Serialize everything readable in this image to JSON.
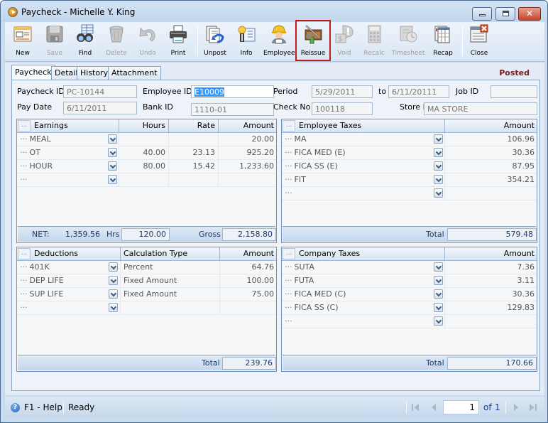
{
  "window": {
    "title": "Paycheck - Michelle Y. King",
    "controls": [
      "minimize",
      "maximize",
      "close"
    ]
  },
  "toolbar": {
    "buttons": [
      {
        "label": "New",
        "icon": "new-record-icon",
        "enabled": true
      },
      {
        "label": "Save",
        "icon": "floppy-disk-icon",
        "enabled": false
      },
      {
        "label": "Find",
        "icon": "binoculars-icon",
        "enabled": true
      },
      {
        "label": "Delete",
        "icon": "trash-can-icon",
        "enabled": false
      },
      {
        "label": "Undo",
        "icon": "undo-arrow-icon",
        "enabled": false
      },
      {
        "label": "Print",
        "icon": "printer-icon",
        "enabled": true
      },
      {
        "label": "Unpost",
        "icon": "unpost-icon",
        "enabled": true
      },
      {
        "label": "Info",
        "icon": "info-badge-icon",
        "enabled": true
      },
      {
        "label": "Employee",
        "icon": "employee-hardhat-icon",
        "enabled": true
      },
      {
        "label": "Reissue",
        "icon": "reissue-tools-icon",
        "enabled": true,
        "highlighted": true
      },
      {
        "label": "Void",
        "icon": "void-money-icon",
        "enabled": false
      },
      {
        "label": "Recalc",
        "icon": "calculator-icon",
        "enabled": false
      },
      {
        "label": "Timesheet",
        "icon": "timesheet-clock-icon",
        "enabled": false
      },
      {
        "label": "Recap",
        "icon": "recap-report-icon",
        "enabled": true
      },
      {
        "label": "Close",
        "icon": "close-window-icon",
        "enabled": true
      }
    ]
  },
  "tabs": [
    {
      "label": "Paycheck",
      "active": true
    },
    {
      "label": "Detail",
      "active": false
    },
    {
      "label": "History",
      "active": false
    },
    {
      "label": "Attachment",
      "active": false
    }
  ],
  "status_label": "Posted",
  "status_color": "#7a1b1b",
  "fields": {
    "paycheck_id": {
      "label": "Paycheck ID",
      "value": "PC-10144"
    },
    "employee_id": {
      "label": "Employee ID",
      "value": "E10009"
    },
    "period": {
      "label": "Period",
      "value": "5/29/2011"
    },
    "period_to": {
      "label": "to",
      "value": "6/11/20111"
    },
    "job_id": {
      "label": "Job ID",
      "value": ""
    },
    "pay_date": {
      "label": "Pay Date",
      "value": "6/11/2011"
    },
    "bank_id": {
      "label": "Bank ID",
      "value": "1110-01"
    },
    "check_no": {
      "label": "Check No",
      "value": "100118"
    },
    "store_id": {
      "label": "Store ID",
      "value": "MA STORE"
    }
  },
  "earnings": {
    "columns": [
      "Earnings",
      "Hours",
      "Rate",
      "Amount"
    ],
    "rows": [
      {
        "name": "MEAL",
        "hours": "",
        "rate": "",
        "amount": "20.00"
      },
      {
        "name": "OT",
        "hours": "40.00",
        "rate": "23.13",
        "amount": "925.20"
      },
      {
        "name": "HOUR",
        "hours": "80.00",
        "rate": "15.42",
        "amount": "1,233.60"
      },
      {
        "name": "",
        "hours": "",
        "rate": "",
        "amount": ""
      }
    ],
    "footer": {
      "net_label": "NET:",
      "net_value": "1,359.56",
      "hrs_label": "Hrs",
      "hrs_value": "120.00",
      "gross_label": "Gross",
      "gross_value": "2,158.80"
    }
  },
  "employee_taxes": {
    "columns": [
      "Employee Taxes",
      "Amount"
    ],
    "rows": [
      {
        "name": "MA",
        "amount": "106.96"
      },
      {
        "name": "FICA MED (E)",
        "amount": "30.36"
      },
      {
        "name": "FICA SS (E)",
        "amount": "87.95"
      },
      {
        "name": "FIT",
        "amount": "354.21"
      },
      {
        "name": "",
        "amount": ""
      }
    ],
    "footer": {
      "total_label": "Total",
      "total_value": "579.48"
    }
  },
  "deductions": {
    "columns": [
      "Deductions",
      "Calculation Type",
      "Amount"
    ],
    "rows": [
      {
        "name": "401K",
        "calc_type": "Percent",
        "amount": "64.76"
      },
      {
        "name": "DEP LIFE",
        "calc_type": "Fixed Amount",
        "amount": "100.00"
      },
      {
        "name": "SUP LIFE",
        "calc_type": "Fixed Amount",
        "amount": "75.00"
      },
      {
        "name": "",
        "calc_type": "",
        "amount": ""
      }
    ],
    "footer": {
      "total_label": "Total",
      "total_value": "239.76"
    }
  },
  "company_taxes": {
    "columns": [
      "Company Taxes",
      "Amount"
    ],
    "rows": [
      {
        "name": "SUTA",
        "amount": "7.36"
      },
      {
        "name": "FUTA",
        "amount": "3.11"
      },
      {
        "name": "FICA MED (C)",
        "amount": "30.36"
      },
      {
        "name": "FICA SS (C)",
        "amount": "129.83"
      },
      {
        "name": "",
        "amount": ""
      }
    ],
    "footer": {
      "total_label": "Total",
      "total_value": "170.66"
    }
  },
  "statusbar": {
    "help": "F1 - Help",
    "state": "Ready",
    "page": "1",
    "of_label": "of",
    "total_pages": "1"
  },
  "row_prefix": "···",
  "header_dots": "..."
}
